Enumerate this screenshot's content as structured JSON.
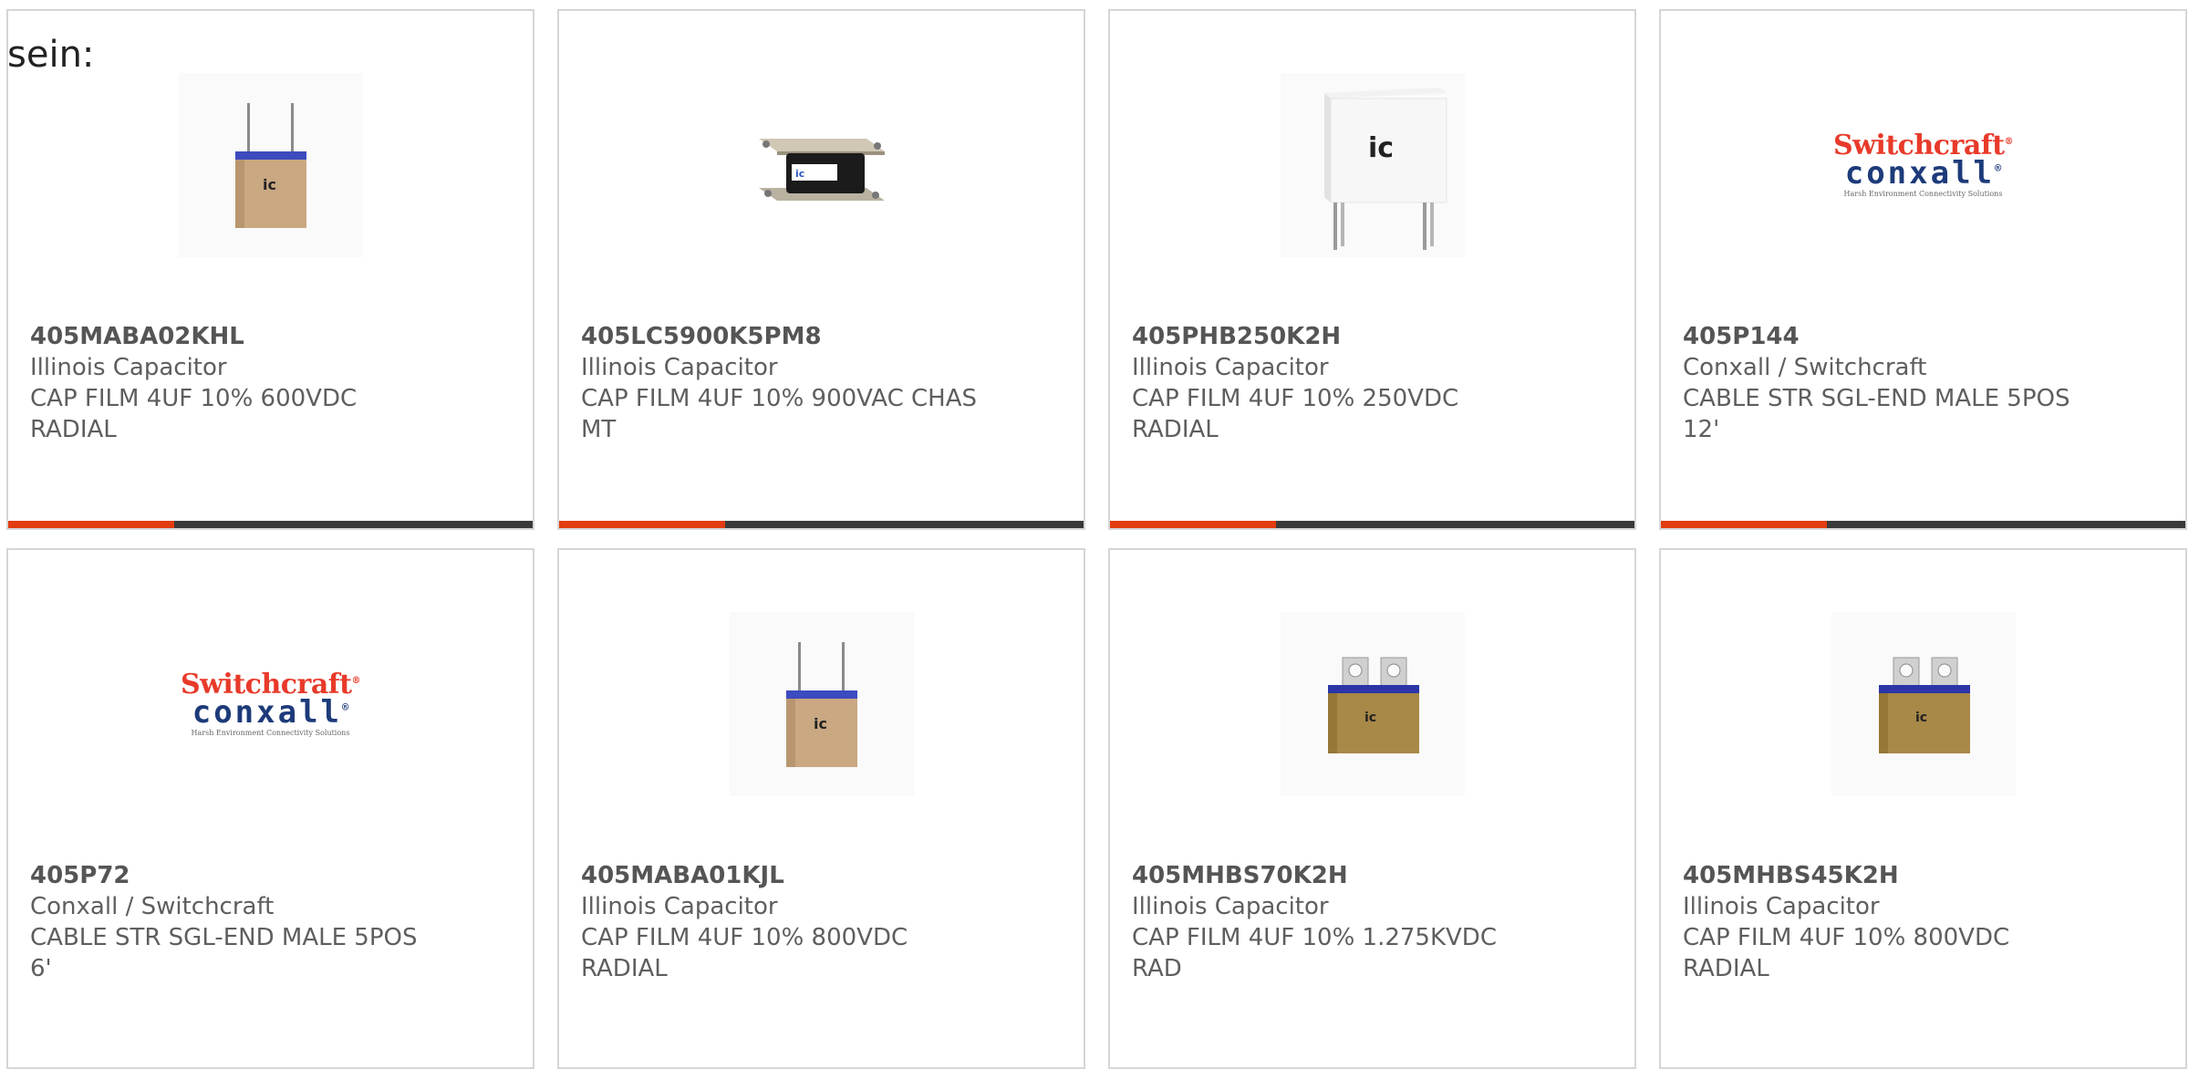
{
  "intro_text": "sein:",
  "products": [
    {
      "part_number": "405MABA02KHL",
      "manufacturer": "Illinois Capacitor",
      "desc_line1": "CAP FILM 4UF 10% 600VDC",
      "desc_line2": "RADIAL",
      "image": "radial-capacitor-image"
    },
    {
      "part_number": "405LC5900K5PM8",
      "manufacturer": "Illinois Capacitor",
      "desc_line1": "CAP FILM 4UF 10% 900VAC CHAS",
      "desc_line2": "MT",
      "image": "chassis-mount-capacitor-image"
    },
    {
      "part_number": "405PHB250K2H",
      "manufacturer": "Illinois Capacitor",
      "desc_line1": "CAP FILM 4UF 10% 250VDC",
      "desc_line2": "RADIAL",
      "image": "box-capacitor-image"
    },
    {
      "part_number": "405P144",
      "manufacturer": "Conxall / Switchcraft",
      "desc_line1": "CABLE STR SGL-END MALE 5POS",
      "desc_line2": "12'",
      "image": "switchcraft-conxall-logo",
      "logo": {
        "line1": "Switchcraft",
        "line2": "conxall",
        "mark": "®",
        "tagline": "Harsh Environment Connectivity Solutions"
      }
    },
    {
      "part_number": "405P72",
      "manufacturer": "Conxall / Switchcraft",
      "desc_line1": "CABLE STR SGL-END MALE 5POS",
      "desc_line2": "6'",
      "image": "switchcraft-conxall-logo",
      "logo": {
        "line1": "Switchcraft",
        "line2": "conxall",
        "mark": "®",
        "tagline": "Harsh Environment Connectivity Solutions"
      }
    },
    {
      "part_number": "405MABA01KJL",
      "manufacturer": "Illinois Capacitor",
      "desc_line1": "CAP FILM 4UF 10% 800VDC",
      "desc_line2": "RADIAL",
      "image": "radial-capacitor-image"
    },
    {
      "part_number": "405MHBS70K2H",
      "manufacturer": "Illinois Capacitor",
      "desc_line1": "CAP FILM 4UF 10% 1.275KVDC",
      "desc_line2": "RAD",
      "image": "tab-terminal-capacitor-image"
    },
    {
      "part_number": "405MHBS45K2H",
      "manufacturer": "Illinois Capacitor",
      "desc_line1": "CAP FILM 4UF 10% 800VDC",
      "desc_line2": "RADIAL",
      "image": "tab-terminal-capacitor-image"
    }
  ],
  "colors": {
    "accent": "#e23c10",
    "bar": "#3a3a3a",
    "border": "#d6d6d6",
    "logo_red": "#e83a2a",
    "logo_blue": "#1d3b7a"
  }
}
